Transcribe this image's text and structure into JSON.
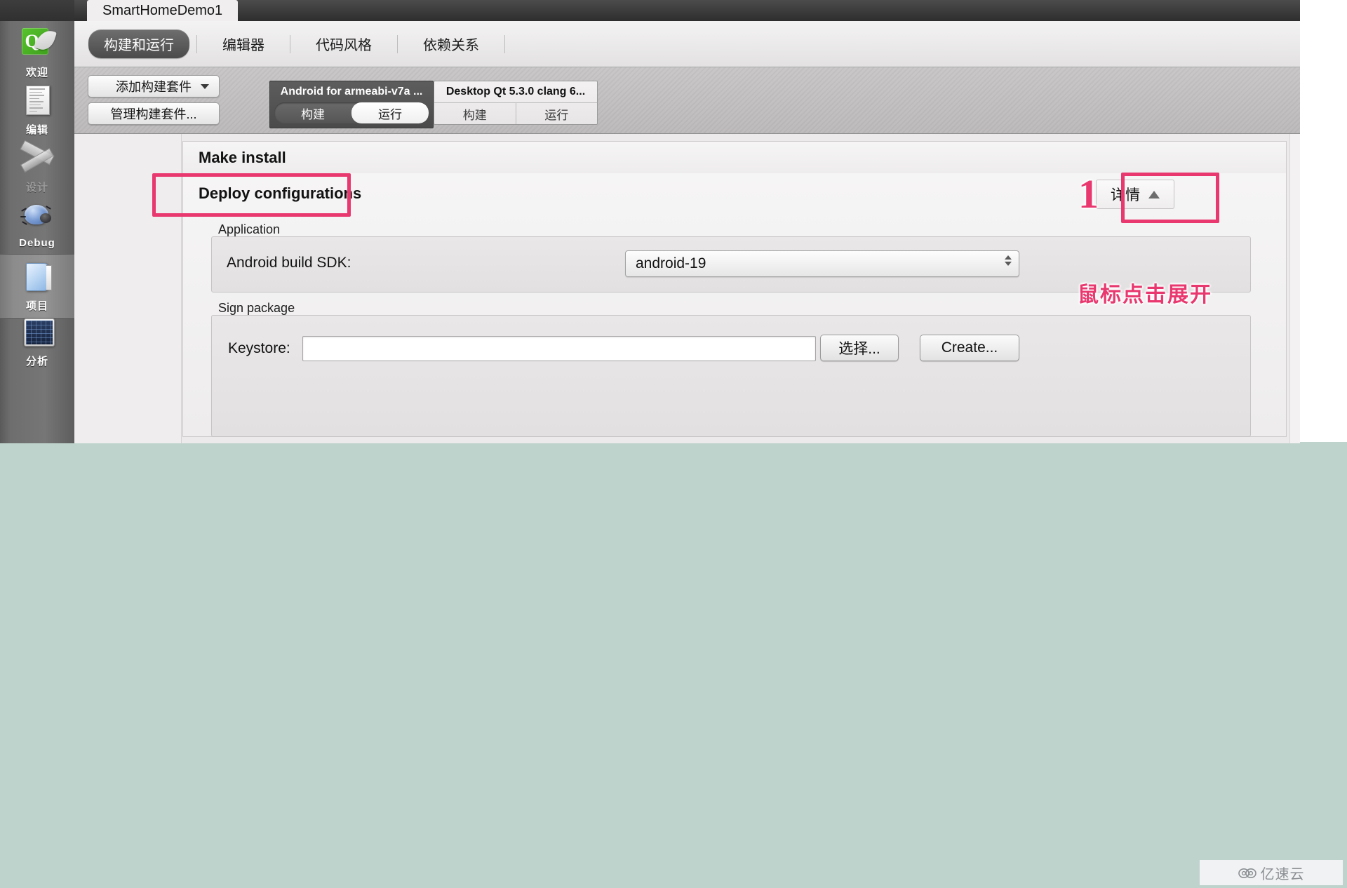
{
  "window": {
    "project_tab": "SmartHomeDemo1"
  },
  "sidebar": {
    "items": [
      {
        "label": "欢迎",
        "icon": "qt-logo-icon",
        "state": "normal"
      },
      {
        "label": "编辑",
        "icon": "document-icon",
        "state": "normal"
      },
      {
        "label": "设计",
        "icon": "ruler-pen-icon",
        "state": "disabled"
      },
      {
        "label": "Debug",
        "icon": "bug-icon",
        "state": "normal"
      },
      {
        "label": "项目",
        "icon": "folder-icon",
        "state": "active"
      },
      {
        "label": "分析",
        "icon": "chart-icon",
        "state": "normal"
      }
    ]
  },
  "categories": [
    {
      "label": "构建和运行",
      "active": true
    },
    {
      "label": "编辑器",
      "active": false
    },
    {
      "label": "代码风格",
      "active": false
    },
    {
      "label": "依赖关系",
      "active": false
    }
  ],
  "kit_panel": {
    "add_kit_button": "添加构建套件",
    "manage_kits_button": "管理构建套件...",
    "kits": [
      {
        "title": "Android for armeabi-v7a ...",
        "selected": true,
        "segments": [
          {
            "label": "构建",
            "on": false
          },
          {
            "label": "运行",
            "on": true
          }
        ]
      },
      {
        "title": "Desktop Qt 5.3.0 clang 6...",
        "selected": false,
        "segments": [
          {
            "label": "构建",
            "on": false
          },
          {
            "label": "运行",
            "on": false
          }
        ]
      }
    ]
  },
  "main": {
    "make_install_title": "Make install",
    "deploy_title": "Deploy configurations",
    "details_button": {
      "label": "详情",
      "caret": "chevron-up-icon"
    },
    "application_group": {
      "label": "Application",
      "sdk_field_label": "Android build SDK:",
      "sdk_value": "android-19"
    },
    "sign_group": {
      "label": "Sign package",
      "keystore_label": "Keystore:",
      "keystore_value": "",
      "choose_button": "选择...",
      "create_button": "Create..."
    }
  },
  "annotations": {
    "step_number": "1",
    "hint_text": "鼠标点击展开",
    "accent_color": "#e8386f"
  },
  "watermark": {
    "text": "亿速云",
    "icon": "cloud-icon"
  }
}
